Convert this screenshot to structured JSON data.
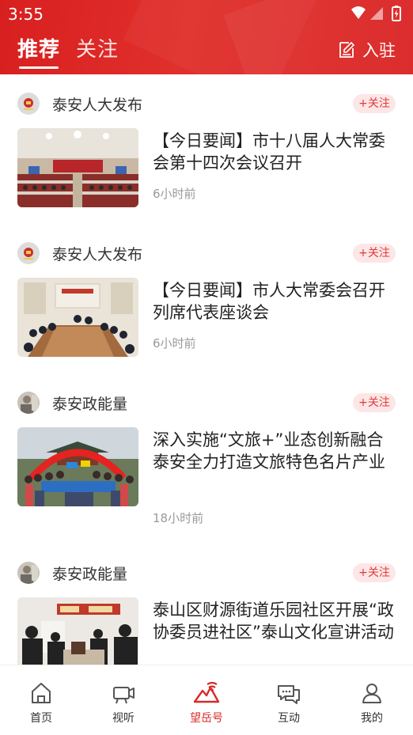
{
  "status_bar": {
    "time": "3:55"
  },
  "header": {
    "tabs": [
      {
        "label": "推荐"
      },
      {
        "label": "关注"
      }
    ],
    "join_label": "入驻"
  },
  "feed": [
    {
      "source": "泰安人大发布",
      "follow_label": "+关注",
      "title": "【今日要闻】市十八届人大常委会第十四次会议召开",
      "time": "6小时前"
    },
    {
      "source": "泰安人大发布",
      "follow_label": "+关注",
      "title": "【今日要闻】市人大常委会召开列席代表座谈会",
      "time": "6小时前"
    },
    {
      "source": "泰安政能量",
      "follow_label": "+关注",
      "title": "深入实施“文旅+”业态创新融合 泰安全力打造文旅特色名片产业",
      "time": "18小时前"
    },
    {
      "source": "泰安政能量",
      "follow_label": "+关注",
      "title": "泰山区财源街道乐园社区开展“政协委员进社区”泰山文化宣讲活动",
      "time": ""
    }
  ],
  "bottom_nav": [
    {
      "label": "首页",
      "icon": "home-icon"
    },
    {
      "label": "视听",
      "icon": "video-camera-icon"
    },
    {
      "label": "望岳号",
      "icon": "wangyue-mountain-icon",
      "active": true
    },
    {
      "label": "互动",
      "icon": "chat-bubbles-icon"
    },
    {
      "label": "我的",
      "icon": "person-icon"
    }
  ],
  "colors": {
    "brand_red": "#d72b2b",
    "follow_bg": "#fde6e6",
    "follow_text": "#e03a3a"
  }
}
